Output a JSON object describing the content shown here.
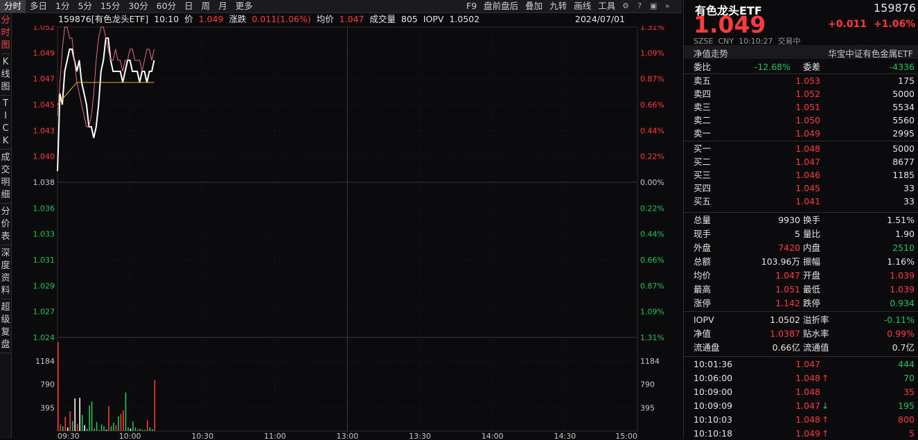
{
  "topbar": {
    "tabs": [
      "分时",
      "多日",
      "1分",
      "5分",
      "15分",
      "30分",
      "60分",
      "日",
      "周",
      "月",
      "更多"
    ],
    "right": [
      "F9",
      "盘前盘后",
      "叠加",
      "九转",
      "画线",
      "工具"
    ]
  },
  "sidenav": {
    "items": [
      "分时图",
      "K线图",
      "TICK",
      "成交明细",
      "分价表",
      "深度资料",
      "超级复盘"
    ]
  },
  "infobar": {
    "code_name": "159876[有色龙头ETF]",
    "time": "10:10",
    "price_label": "价",
    "price": "1.049",
    "change_label": "涨跌",
    "change": "0.011(1.06%)",
    "avg_label": "均价",
    "avg": "1.047",
    "vol_label": "成交量",
    "vol": "805",
    "iopv_label": "IOPV",
    "iopv": "1.0502",
    "date": "2024/07/01"
  },
  "chart_data": {
    "type": "line",
    "title": "159876[有色龙头ETF]",
    "prev_close": 1.038,
    "ylim": [
      1.024,
      1.052
    ],
    "y_ticks_left": [
      "1.052",
      "1.049",
      "1.047",
      "1.045",
      "1.043",
      "1.040",
      "1.038",
      "1.036",
      "1.033",
      "1.031",
      "1.029",
      "1.027",
      "1.024"
    ],
    "y_ticks_right": [
      "1.31%",
      "1.09%",
      "0.87%",
      "0.66%",
      "0.44%",
      "0.22%",
      "0.00%",
      "0.22%",
      "0.44%",
      "0.66%",
      "0.87%",
      "1.09%",
      "1.31%"
    ],
    "x_ticks": [
      "09:30",
      "10:00",
      "10:30",
      "11:00",
      "13:00",
      "13:30",
      "14:00",
      "14:30",
      "15:00"
    ],
    "volume_ticks": [
      "1184",
      "790",
      "395"
    ],
    "series": [
      {
        "name": "价",
        "color": "#ffffff",
        "x": [
          0,
          1,
          2,
          3,
          4,
          5,
          6,
          7,
          8,
          9,
          10,
          11,
          12,
          13,
          14,
          15,
          16,
          17,
          18,
          19,
          20,
          21,
          22,
          23,
          24,
          25,
          26,
          27,
          28,
          29,
          30,
          31,
          32,
          33,
          34,
          35,
          36,
          37,
          38,
          39,
          40
        ],
        "values": [
          1.039,
          1.046,
          1.045,
          1.048,
          1.049,
          1.05,
          1.05,
          1.049,
          1.048,
          1.049,
          1.047,
          1.046,
          1.045,
          1.043,
          1.043,
          1.042,
          1.043,
          1.045,
          1.048,
          1.049,
          1.051,
          1.051,
          1.049,
          1.048,
          1.048,
          1.048,
          1.048,
          1.047,
          1.048,
          1.049,
          1.049,
          1.048,
          1.048,
          1.048,
          1.047,
          1.048,
          1.048,
          1.047,
          1.048,
          1.048,
          1.049
        ]
      },
      {
        "name": "IOPV",
        "color": "#e56a8c",
        "x": [
          0,
          1,
          2,
          3,
          4,
          5,
          6,
          7,
          8,
          9,
          10,
          11,
          12,
          13,
          14,
          15,
          16,
          17,
          18,
          19,
          20,
          21,
          22,
          23,
          24,
          25,
          26,
          27,
          28,
          29,
          30,
          31,
          32,
          33,
          34,
          35,
          36,
          37,
          38,
          39,
          40
        ],
        "values": [
          1.044,
          1.047,
          1.05,
          1.052,
          1.052,
          1.051,
          1.051,
          1.049,
          1.047,
          1.046,
          1.045,
          1.044,
          1.043,
          1.043,
          1.044,
          1.046,
          1.049,
          1.051,
          1.052,
          1.052,
          1.051,
          1.05,
          1.049,
          1.049,
          1.05,
          1.049,
          1.049,
          1.048,
          1.049,
          1.049,
          1.05,
          1.05,
          1.049,
          1.049,
          1.049,
          1.048,
          1.049,
          1.05,
          1.05,
          1.049,
          1.05
        ]
      },
      {
        "name": "均价",
        "color": "#e0b020",
        "x": [
          0,
          2,
          4,
          6,
          8,
          10,
          12,
          14,
          16,
          18,
          20,
          22,
          24,
          26,
          28,
          30,
          32,
          34,
          36,
          38,
          40
        ],
        "values": [
          1.045,
          1.0455,
          1.046,
          1.0465,
          1.047,
          1.047,
          1.047,
          1.047,
          1.047,
          1.047,
          1.047,
          1.047,
          1.047,
          1.047,
          1.047,
          1.047,
          1.047,
          1.047,
          1.047,
          1.047,
          1.047
        ]
      }
    ],
    "volume": {
      "x": [
        0,
        1,
        2,
        3,
        4,
        5,
        6,
        7,
        8,
        9,
        10,
        11,
        12,
        13,
        14,
        15,
        16,
        17,
        18,
        19,
        20,
        21,
        22,
        23,
        24,
        25,
        26,
        27,
        28,
        29,
        30,
        31,
        32,
        33,
        34,
        35,
        36,
        37,
        38,
        39,
        40
      ],
      "values": [
        1500,
        110,
        80,
        240,
        60,
        330,
        170,
        550,
        120,
        560,
        270,
        100,
        40,
        430,
        500,
        40,
        150,
        20,
        110,
        80,
        20,
        420,
        80,
        140,
        100,
        250,
        290,
        350,
        650,
        60,
        40,
        160,
        60,
        30,
        40,
        20,
        20,
        180,
        60,
        30,
        860
      ],
      "colors": [
        "r",
        "r",
        "g",
        "r",
        "w",
        "r",
        "g",
        "w",
        "r",
        "w",
        "g",
        "w",
        "g",
        "g",
        "g",
        "g",
        "g",
        "r",
        "g",
        "g",
        "w",
        "r",
        "g",
        "g",
        "r",
        "g",
        "r",
        "r",
        "g",
        "g",
        "w",
        "g",
        "g",
        "r",
        "g",
        "g",
        "g",
        "r",
        "g",
        "g",
        "r"
      ]
    }
  },
  "right_panel": {
    "name": "有色龙头ETF",
    "code": "159876",
    "price": "1.049",
    "change": "+0.011",
    "change_pct": "+1.06%",
    "exchange": "SZSE",
    "currency": "CNY",
    "time": "10:10:27",
    "status": "交易中",
    "nav_trend_label": "净值走势",
    "fund_name": "华宝中证有色金属ETF",
    "weibi_label": "委比",
    "weibi": "-12.68%",
    "weicha_label": "委差",
    "weicha": "-4336",
    "asks": [
      {
        "label": "卖五",
        "price": "1.053",
        "vol": "175"
      },
      {
        "label": "卖四",
        "price": "1.052",
        "vol": "5000"
      },
      {
        "label": "卖三",
        "price": "1.051",
        "vol": "5534"
      },
      {
        "label": "卖二",
        "price": "1.050",
        "vol": "5560"
      },
      {
        "label": "卖一",
        "price": "1.049",
        "vol": "2995"
      }
    ],
    "bids": [
      {
        "label": "买一",
        "price": "1.048",
        "vol": "5000"
      },
      {
        "label": "买二",
        "price": "1.047",
        "vol": "8677"
      },
      {
        "label": "买三",
        "price": "1.046",
        "vol": "1185"
      },
      {
        "label": "买四",
        "price": "1.045",
        "vol": "33"
      },
      {
        "label": "买五",
        "price": "1.041",
        "vol": "33"
      }
    ],
    "stats": [
      {
        "l1": "总量",
        "v1": "9930",
        "c1": "white",
        "l2": "换手",
        "v2": "1.51%",
        "c2": "white"
      },
      {
        "l1": "现手",
        "v1": "5",
        "c1": "white",
        "l2": "量比",
        "v2": "1.90",
        "c2": "white"
      },
      {
        "l1": "外盘",
        "v1": "7420",
        "c1": "red",
        "l2": "内盘",
        "v2": "2510",
        "c2": "green"
      },
      {
        "l1": "总额",
        "v1": "103.96万",
        "c1": "white",
        "l2": "振幅",
        "v2": "1.16%",
        "c2": "white"
      },
      {
        "l1": "均价",
        "v1": "1.047",
        "c1": "red",
        "l2": "开盘",
        "v2": "1.039",
        "c2": "red"
      },
      {
        "l1": "最高",
        "v1": "1.051",
        "c1": "red",
        "l2": "最低",
        "v2": "1.039",
        "c2": "red"
      },
      {
        "l1": "涨停",
        "v1": "1.142",
        "c1": "red",
        "l2": "跌停",
        "v2": "0.934",
        "c2": "green"
      }
    ],
    "stats2": [
      {
        "l1": "IOPV",
        "v1": "1.0502",
        "c1": "white",
        "l2": "溢折率",
        "v2": "-0.11%",
        "c2": "green"
      },
      {
        "l1": "净值",
        "v1": "1.0387",
        "c1": "red",
        "l2": "贴水率",
        "v2": "0.99%",
        "c2": "red"
      },
      {
        "l1": "流通盘",
        "v1": "0.66亿",
        "c1": "white",
        "l2": "流通值",
        "v2": "0.7亿",
        "c2": "white"
      }
    ],
    "ticks": [
      {
        "time": "10:01:36",
        "price": "1.047",
        "arrow": "",
        "vol": "444",
        "vc": "green"
      },
      {
        "time": "10:06:00",
        "price": "1.048",
        "arrow": "↑",
        "vol": "70",
        "vc": "green"
      },
      {
        "time": "10:09:00",
        "price": "1.048",
        "arrow": "",
        "vol": "35",
        "vc": "red"
      },
      {
        "time": "10:09:09",
        "price": "1.047",
        "arrow": "↓",
        "vol": "195",
        "vc": "green"
      },
      {
        "time": "10:10:03",
        "price": "1.048",
        "arrow": "↑",
        "vol": "800",
        "vc": "red"
      },
      {
        "time": "10:10:18",
        "price": "1.049",
        "arrow": "↑",
        "vol": "5",
        "vc": "red"
      }
    ]
  }
}
